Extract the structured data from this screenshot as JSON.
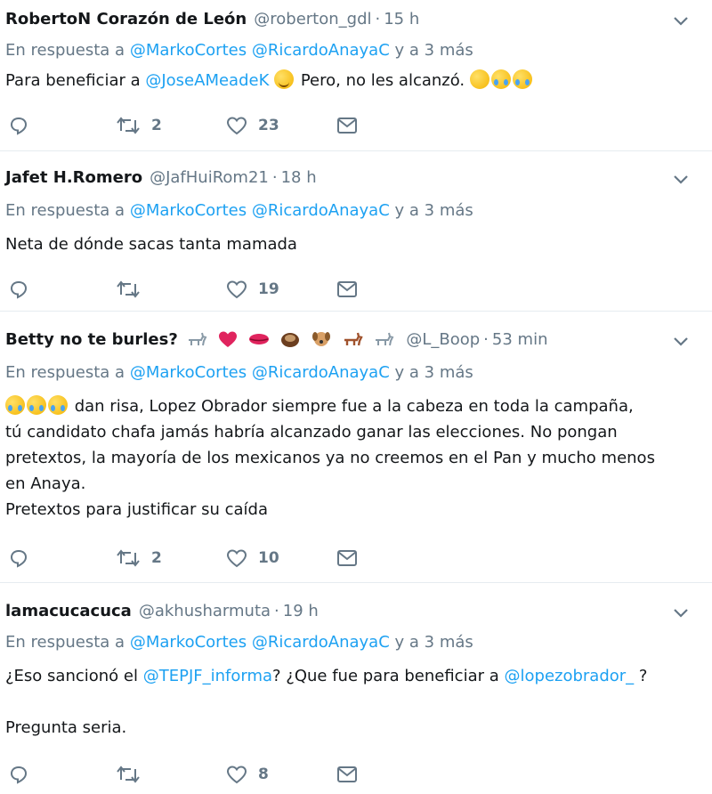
{
  "tweets": [
    {
      "name": "RobertoN Corazón de León",
      "handle": "@roberton_gdl",
      "time": "15 h",
      "reply_prefix": "En respuesta a",
      "reply_mentions": [
        "@MarkoCortes",
        "@RicardoAnayaC"
      ],
      "reply_suffix": "y a 3 más",
      "text_a": "Para beneficiar a ",
      "text_mention": "@JoseAMeadeK",
      "text_b": "  Pero, no les alcanzó.",
      "retweets": "2",
      "likes": "23"
    },
    {
      "name": "Jafet H.Romero",
      "handle": "@JafHuiRom21",
      "time": "18 h",
      "reply_prefix": "En respuesta a",
      "reply_mentions": [
        "@MarkoCortes",
        "@RicardoAnayaC"
      ],
      "reply_suffix": "y a 3 más",
      "text": "Neta de dónde sacas tanta mamada",
      "retweets": "",
      "likes": "19"
    },
    {
      "name": "Betty no te burles?",
      "handle": "@L_Boop",
      "time": "53 min",
      "reply_prefix": "En respuesta a",
      "reply_mentions": [
        "@MarkoCortes",
        "@RicardoAnayaC"
      ],
      "reply_suffix": "y a 3 más",
      "lines": [
        " dan risa, Lopez Obrador siempre fue a la cabeza en toda la campaña,",
        "tú candidato chafa jamás habría alcanzado ganar las elecciones. No pongan",
        "pretextos, la mayoría de los mexicanos ya no creemos en el Pan y mucho menos",
        "en Anaya.",
        "Pretextos para justificar su caída"
      ],
      "retweets": "2",
      "likes": "10"
    },
    {
      "name": "lamacucacuca",
      "handle": "@akhusharmuta",
      "time": "19 h",
      "reply_prefix": "En respuesta a",
      "reply_mentions": [
        "@MarkoCortes",
        "@RicardoAnayaC"
      ],
      "reply_suffix": "y a 3 más",
      "text_a": "¿Eso sancionó el ",
      "text_mention1": "@TEPJF_informa",
      "text_b": "? ¿Que fue para beneficiar a ",
      "text_mention2": "@lopezobrador_",
      "text_c": " ?",
      "text_2": "Pregunta seria.",
      "retweets": "",
      "likes": "8"
    }
  ],
  "separator": "·",
  "colors": {
    "link": "#1da1f2",
    "muted": "#657786",
    "text": "#14171a",
    "border": "#e6ecf0"
  },
  "icons": [
    "caret-down-icon",
    "reply-icon",
    "retweet-icon",
    "like-icon",
    "message-icon"
  ]
}
